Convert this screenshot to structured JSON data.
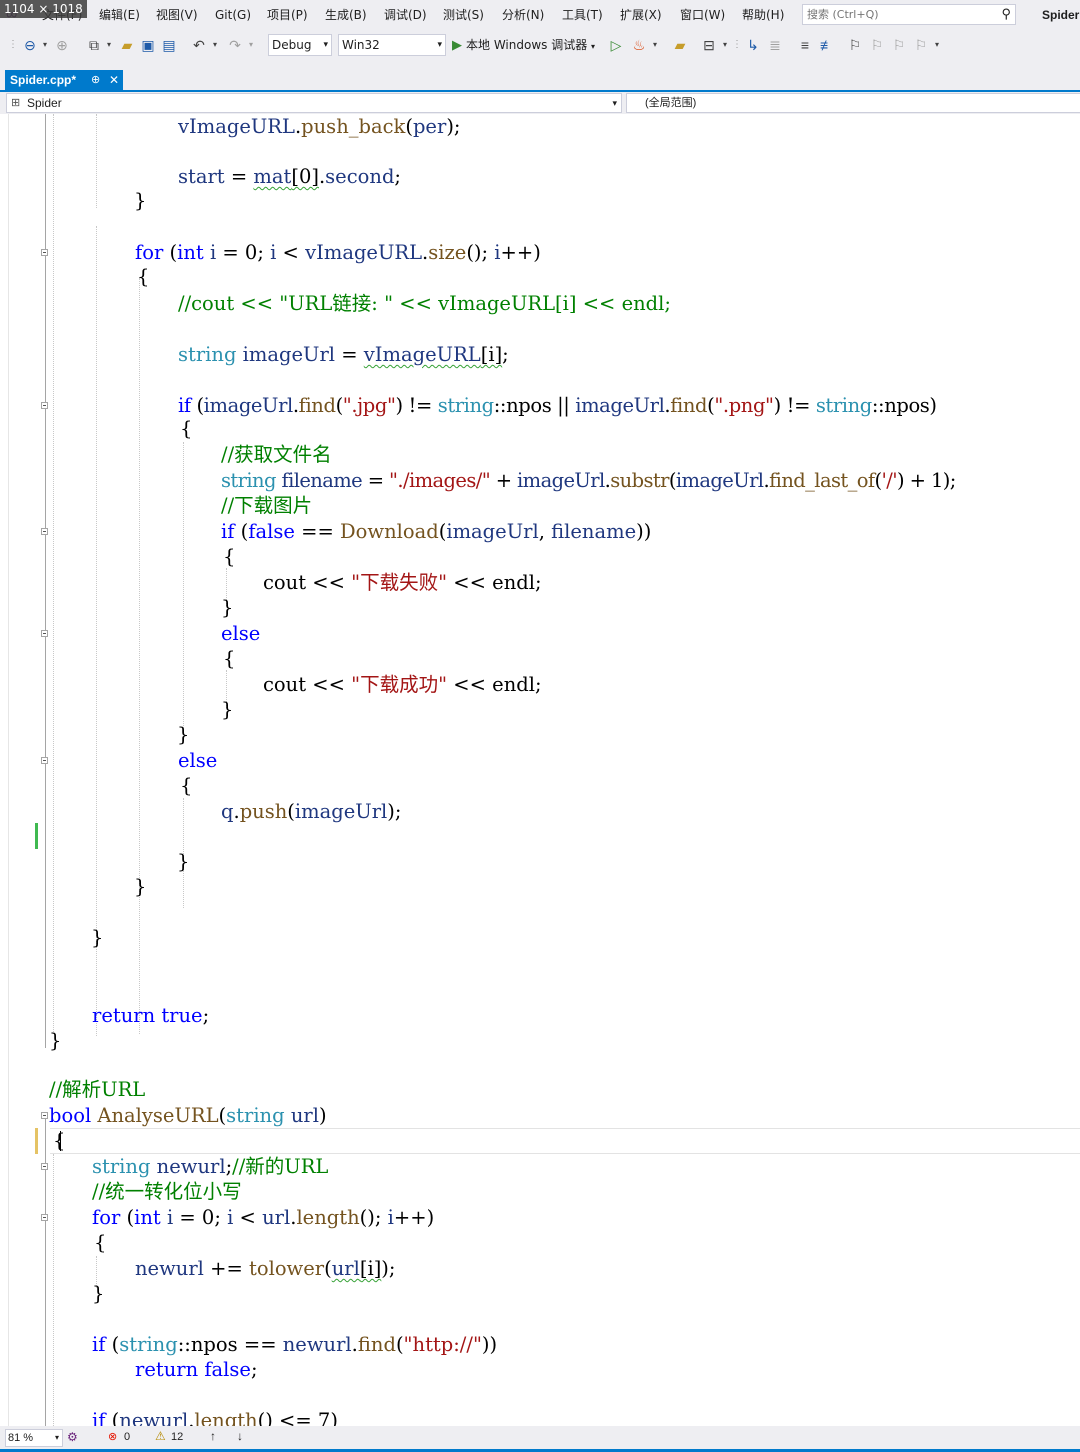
{
  "overlay": {
    "dimensions": "1104 × 1018"
  },
  "menu": {
    "items": [
      "文件(F)",
      "编辑(E)",
      "视图(V)",
      "Git(G)",
      "项目(P)",
      "生成(B)",
      "调试(D)",
      "测试(S)",
      "分析(N)",
      "工具(T)",
      "扩展(X)",
      "窗口(W)",
      "帮助(H)"
    ],
    "search_placeholder": "搜索 (Ctrl+Q)",
    "solution_name": "Spider"
  },
  "toolbar": {
    "config": "Debug",
    "platform": "Win32",
    "run_label": "本地 Windows 调试器"
  },
  "tab": {
    "name": "Spider.cpp*",
    "pin": "⊕",
    "close": "✕"
  },
  "nav": {
    "scope_left": "Spider",
    "scope_right": "(全局范围)"
  },
  "colors": {
    "accent": "#007acc",
    "keyword": "#0000ff",
    "type": "#2b91af",
    "string": "#a31515",
    "comment": "#008000"
  },
  "code": {
    "l0": [
      "vImageURL",
      ".",
      "push_back",
      "(",
      "per",
      ");"
    ],
    "l1": [
      "start",
      " = ",
      "mat",
      "[0]",
      ".",
      "second",
      ";"
    ],
    "l2": "}",
    "l3": [
      "for",
      " (",
      "int",
      " ",
      "i",
      " = 0; ",
      "i",
      " < ",
      "vImageURL",
      ".",
      "size",
      "(); ",
      "i",
      "++)"
    ],
    "l4": "{",
    "l5": "//cout << \"URL链接: \" << vImageURL[i] << endl;",
    "l6": [
      "string",
      " ",
      "imageUrl",
      " = ",
      "vImageURL",
      "[i]",
      ";"
    ],
    "l7": [
      "if",
      " (",
      "imageUrl",
      ".",
      "find",
      "(",
      "\".jpg\"",
      ") != ",
      "string",
      "::",
      "npos",
      " || ",
      "imageUrl",
      ".",
      "find",
      "(",
      "\".png\"",
      ") != ",
      "string",
      "::",
      "npos",
      ")"
    ],
    "l8": "{",
    "l9": "//获取文件名",
    "l10": [
      "string",
      " ",
      "filename",
      " = ",
      "\"./images/\"",
      " + ",
      "imageUrl",
      ".",
      "substr",
      "(",
      "imageUrl",
      ".",
      "find_last_of",
      "(",
      "'/'",
      ") + 1);"
    ],
    "l11": "//下载图片",
    "l12": [
      "if",
      " (",
      "false",
      " == ",
      "Download",
      "(",
      "imageUrl",
      ", ",
      "filename",
      "))"
    ],
    "l13": "{",
    "l14": [
      "cout",
      " << ",
      "\"下载失败\"",
      " << ",
      "endl",
      ";"
    ],
    "l15": "}",
    "l16": "else",
    "l17": "{",
    "l18": [
      "cout",
      " << ",
      "\"下载成功\"",
      " << ",
      "endl",
      ";"
    ],
    "l19": "}",
    "l20": "}",
    "l21": "else",
    "l22": "{",
    "l23": [
      "q",
      ".",
      "push",
      "(",
      "imageUrl",
      ");"
    ],
    "l24": "}",
    "l25": "}",
    "l26": "}",
    "l27": [
      "return",
      " ",
      "true",
      ";"
    ],
    "l28": "}",
    "l29": "//解析URL",
    "l30": [
      "bool",
      " ",
      "AnalyseURL",
      "(",
      "string",
      " ",
      "url",
      ")"
    ],
    "l31": "{",
    "l32": [
      "string",
      " ",
      "newurl",
      ";",
      "//新的URL"
    ],
    "l33": "//统一转化位小写",
    "l34": [
      "for",
      " (",
      "int",
      " ",
      "i",
      " = 0; ",
      "i",
      " < ",
      "url",
      ".",
      "length",
      "(); ",
      "i",
      "++)"
    ],
    "l35": "{",
    "l36": [
      "newurl",
      " += ",
      "tolower",
      "(",
      "url",
      "[i]",
      ");"
    ],
    "l37": "}",
    "l38": [
      "if",
      " (",
      "string",
      "::",
      "npos",
      " == ",
      "newurl",
      ".",
      "find",
      "(",
      "\"http://\"",
      "))"
    ],
    "l39": [
      "return",
      " ",
      "false",
      ";"
    ],
    "l40": [
      "if",
      " (",
      "newurl",
      ".",
      "length",
      "() <= 7)"
    ]
  },
  "status": {
    "zoom": "81 %",
    "errors": "0",
    "warnings": "12"
  }
}
